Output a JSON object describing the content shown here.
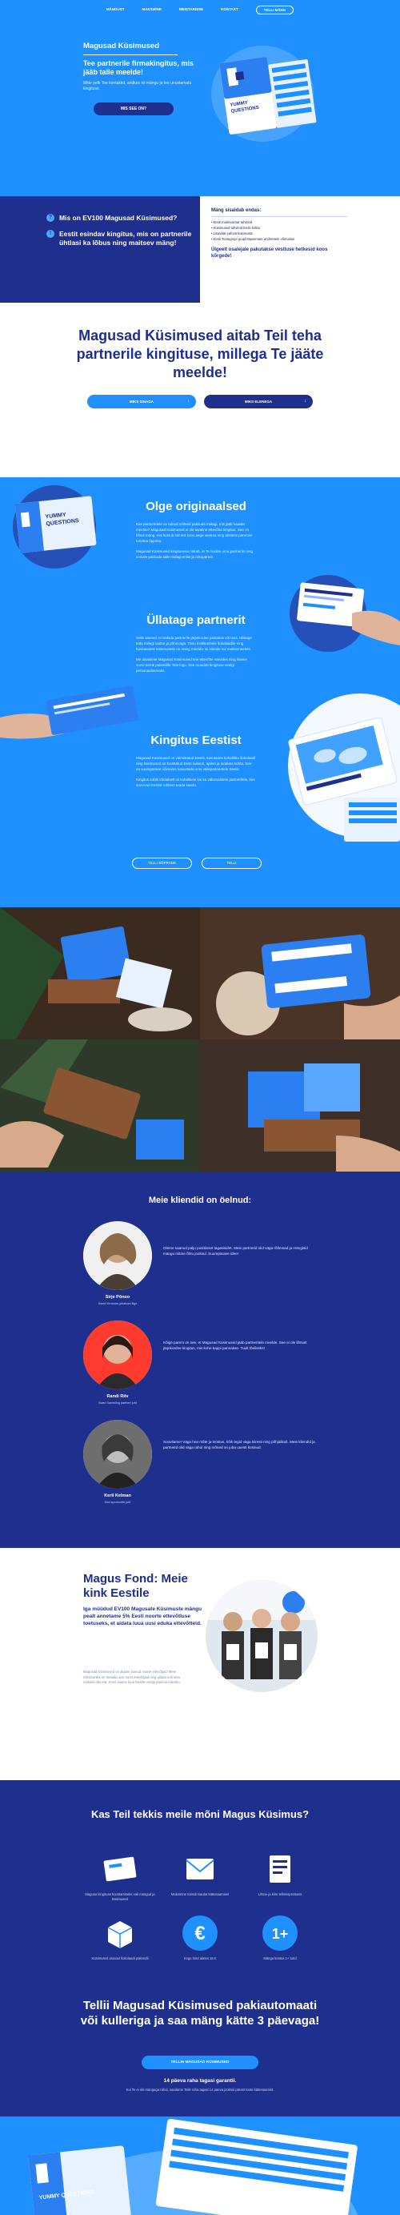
{
  "nav": {
    "items": [
      "MÄNGUST",
      "MAKSMINE",
      "MEISTARISSE",
      "KONTAKT"
    ],
    "cta": "TELLI MÄNG"
  },
  "hero": {
    "title": "Magusad Küsimused",
    "subtitle": "Tee partnerile firmakingitus, mis jääb talle meelde!",
    "desc": "Mitte pelk Tee kontaktid, andkes nii mängu ja tee unustamatu kingituse.",
    "button": "MIS SEE ON?"
  },
  "s2": {
    "q1": "Mis on EV100 Magusad Küsimused?",
    "q2": "Eestit esindav kingitus, mis on partnerile ühtlasi ka lõbus ning maitsev mäng!",
    "heading": "Mäng sisaldab endas:",
    "items": [
      "Eesti maitsvaimat tahvleid",
      "Küsimused tahvleid Eesti kohta",
      "Lisaväär vahvat küsimuste",
      "Eesti Tootegrupi grupil täpsemate andmetele võimalusi"
    ],
    "footer": "Ülgeelt osalejale pakutakse vestluse hetkesid koos kõrgede!"
  },
  "s3": {
    "title": "Magusad Küsimused aitab Teil teha partnerile kingituse, millega Te jääte meelde!",
    "btn1": "MIKS SINAGA",
    "btn2": "MIKS ELENEGA"
  },
  "s4": {
    "f1_title": "Olge originaalsed",
    "f1_p1": "Kas partneridele on tulnud mõtteid pakkuda midagi, mis jääb kauaks meelde? Magusad Küsimused ei ole tavaline ettevõtte kingitus. See on lõbus mäng, mis kutsub inimesi koos aega veetma ning üksteist paremini tundma õppima.",
    "f1_p2": "Magusad Küsimused kingitusena näitab, et Te hoolite oma partnerist ning soovite pakkuda talle midagi erilist ja isikupärast.",
    "f2_title": "Üllatage partnerit",
    "f2_p1": "Selle asemel, et kinkida partnerile järjekordne pastakas või tass, üllatage teda millegi uudse ja põnevaga. Tänu kvaliteetsele šokolaadile ning huvitavatele küsimustele on mäng meeldiv nii silmale kui maitsemeelele.",
    "f2_p2": "Me disainime Magusad Küsimused teie ettevõtte värvides ning lisame soovi korral pakendile Teie logo. See muudab kingituse veelgi personaalsemaks.",
    "f3_title": "Kingitus Eestist",
    "f3_p1": "Magusad Küsimused on valmistatud Eestis, kasutades kohalikku šokolaadi ning küsimused on koostatud Eesti kultuuri, ajaloo ja looduse kohta. See on suurepärane võimalus tutvustada oma välispartneritele Eestit.",
    "f3_p2": "Kingitus sobib ideaalselt nii kohalikele kui ka välismaistele partneritele, kes soovivad Eestist rohkem teada saada.",
    "btn1": "TELLI SÕPRADE",
    "btn2": "TELLI"
  },
  "testimonials": {
    "title": "Meie kliendid on öelnud:",
    "items": [
      {
        "name": "Sirje Põnoo",
        "role": "Swed Ventures juhatuse liige",
        "quote": "Oleme saanud palju positiivset tagasisidet. Meie partnerid olid väga rõõmsad ja mängisid mängu mitme õhtu jooksul. Suurepärane idee!"
      },
      {
        "name": "Randi Riiv",
        "role": "Swed Gambling partneri juht",
        "quote": "Kõige parem on see, et Magusad Küsimused jääb partneritele meelde. See ei ole lihtsalt järjekordne kingitus, mis kohe kappi pannakse. Tuult tõeliseks!"
      },
      {
        "name": "Kerli Kelman",
        "role": "Kiwi sponsorite juht",
        "quote": "Soovitame! Väga hea mõte ja teostus, kõik tegid väga kiiresti ning põhjalikult. Meie kliendid ja partnerid olid väga rahul ning mõned on juba uuesti küsinud."
      }
    ]
  },
  "fond": {
    "title": "Magus Fond: Meie kink Eestile",
    "lead": "Iga müüdud EV100 Magusate Küsimuste mängu pealt annetame 5% Eesti noorte ettevõtluse toetuseks, et aidata luua uusi eduka ettevõtteid.",
    "body": "Magusad Küsimused on alguse loonud noorte ettevõtjad. Meie missiooniks on toetada uusi noori ettevõtjaid ning aidata neil oma unistusi ellu viia. Koos saame luua Eestile veelgi parema tuleviku."
  },
  "interest": {
    "title": "Kas Teil tekkis meile mõni Magus Küsimus?",
    "items": [
      "Magusa kingituse koostamiseks vali mängud ja küsimused",
      "Maksmine toimub kauba kättesaamisel",
      "Lihtne ja kiire tellimisprotsess",
      "Küsimused asuvad šokolaadi pakendil",
      "Kogu hind alates 15 €",
      "Mängu kestus 1+ tund"
    ],
    "icons": [
      "chocolate-icon",
      "mail-icon",
      "order-icon",
      "box-icon",
      "euro-icon",
      "plus-icon"
    ],
    "euro": "€",
    "plus": "1+",
    "cta": "Tellii Magusad Küsimused pakiautomaati või kulleriga ja saa mäng kätte 3 päevaga!",
    "order_button": "TELLIN MAGUSAD KÜSIMUSED",
    "guarantee": "14 päeva raha tagasi garantii.",
    "guarantee_text": "Kui Te ei ole mänguga rahul, saadame Teile raha tagasi 14 päeva jooksul pärast toote kättesaamist."
  },
  "brand": {
    "box_label": "YUMMY QUESTIONS",
    "primary": "#1e90ff",
    "dark": "#1e2f8e"
  }
}
